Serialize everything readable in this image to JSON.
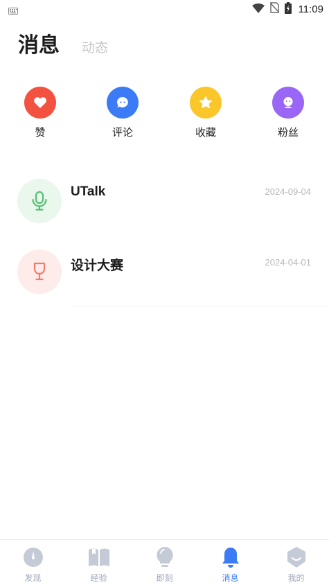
{
  "status_bar": {
    "time": "11:09",
    "icons": [
      "keyboard-icon",
      "wifi-icon",
      "no-sim-icon",
      "battery-icon"
    ]
  },
  "header": {
    "tabs": [
      {
        "label": "消息",
        "active": true
      },
      {
        "label": "动态",
        "active": false
      }
    ]
  },
  "quick_actions": [
    {
      "label": "赞",
      "icon": "heart-icon",
      "color": "#f35240"
    },
    {
      "label": "评论",
      "icon": "comment-icon",
      "color": "#3b7bf6"
    },
    {
      "label": "收藏",
      "icon": "star-icon",
      "color": "#fbc62a"
    },
    {
      "label": "粉丝",
      "icon": "fans-icon",
      "color": "#9a66f5"
    }
  ],
  "messages": [
    {
      "title": "UTalk",
      "date": "2024-09-04",
      "icon": "microphone-icon",
      "icon_color": "#53c071",
      "bg_color": "#eaf7ed"
    },
    {
      "title": "设计大赛",
      "date": "2024-04-01",
      "icon": "trophy-icon",
      "icon_color": "#f47c68",
      "bg_color": "#feecea"
    }
  ],
  "bottom_nav": [
    {
      "label": "发现",
      "icon": "discover-icon",
      "active": false
    },
    {
      "label": "经验",
      "icon": "book-icon",
      "active": false
    },
    {
      "label": "即刻",
      "icon": "bulb-icon",
      "active": false
    },
    {
      "label": "消息",
      "icon": "bell-icon",
      "active": true
    },
    {
      "label": "我的",
      "icon": "profile-icon",
      "active": false
    }
  ],
  "colors": {
    "nav_active": "#3b7bf6",
    "nav_inactive": "#c4cad6"
  }
}
